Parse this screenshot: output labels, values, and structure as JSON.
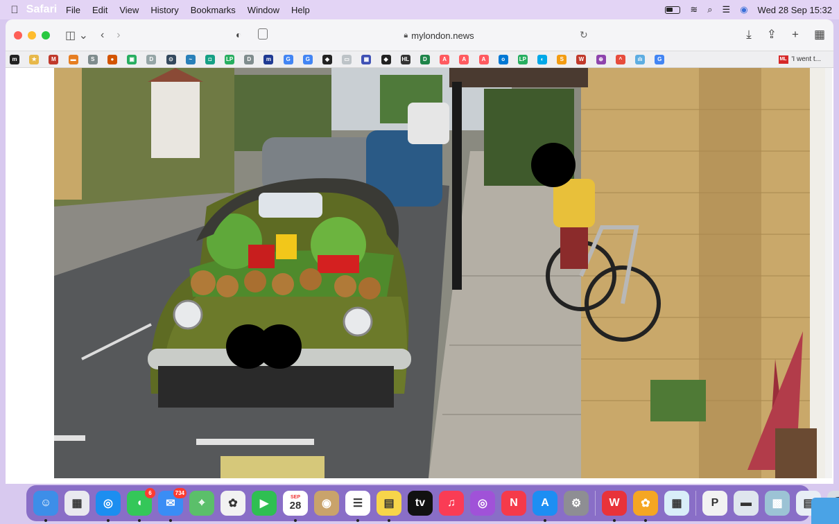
{
  "menubar": {
    "app_name": "Safari",
    "menus": [
      "File",
      "Edit",
      "View",
      "History",
      "Bookmarks",
      "Window",
      "Help"
    ],
    "datetime": "Wed 28 Sep  15:32"
  },
  "toolbar": {
    "url": "mylondon.news"
  },
  "favorites": [
    {
      "label": "m",
      "color": "#222222"
    },
    {
      "label": "★",
      "color": "#e7b84a"
    },
    {
      "label": "M",
      "color": "#c0392b"
    },
    {
      "label": "▬",
      "color": "#e67e22"
    },
    {
      "label": "S",
      "color": "#7f8c8d"
    },
    {
      "label": "●",
      "color": "#d35400"
    },
    {
      "label": "▣",
      "color": "#27ae60"
    },
    {
      "label": "D",
      "color": "#95a5a6"
    },
    {
      "label": "⊙",
      "color": "#34495e"
    },
    {
      "label": "~",
      "color": "#2980b9"
    },
    {
      "label": "◘",
      "color": "#16a085"
    },
    {
      "label": "LP",
      "color": "#27ae60"
    },
    {
      "label": "D",
      "color": "#7f8c8d"
    },
    {
      "label": "m",
      "color": "#1f3a93"
    },
    {
      "label": "G",
      "color": "#4285f4"
    },
    {
      "label": "G",
      "color": "#4285f4"
    },
    {
      "label": "◆",
      "color": "#222222"
    },
    {
      "label": "▭",
      "color": "#bdc3c7"
    },
    {
      "label": "▦",
      "color": "#3f51b5"
    },
    {
      "label": "◆",
      "color": "#222222"
    },
    {
      "label": "HL",
      "color": "#333333"
    },
    {
      "label": "D",
      "color": "#1e8449"
    },
    {
      "label": "A",
      "color": "#ff5a5f"
    },
    {
      "label": "A",
      "color": "#ff5a5f"
    },
    {
      "label": "A",
      "color": "#ff5a5f"
    },
    {
      "label": "o",
      "color": "#0078d4"
    },
    {
      "label": "LP",
      "color": "#27ae60"
    },
    {
      "label": "◐",
      "color": "#00a8e8"
    },
    {
      "label": "S",
      "color": "#f39c12"
    },
    {
      "label": "W",
      "color": "#c0392b"
    },
    {
      "label": "⊕",
      "color": "#8e44ad"
    },
    {
      "label": "^",
      "color": "#e74c3c"
    },
    {
      "label": "ılı",
      "color": "#5dade2"
    },
    {
      "label": "G",
      "color": "#4285f4"
    }
  ],
  "favorites_last": {
    "logo": "ML",
    "label": "'I went t..."
  },
  "dock": {
    "apps": [
      {
        "name": "finder",
        "label": "☺",
        "color": "#3d8ee8"
      },
      {
        "name": "launchpad",
        "label": "▦",
        "color": "#e9e9ef"
      },
      {
        "name": "safari",
        "label": "◎",
        "color": "#1c8ef0"
      },
      {
        "name": "messages",
        "label": "◖",
        "color": "#34c759",
        "badge": "6"
      },
      {
        "name": "mail",
        "label": "✉",
        "color": "#3a8df5",
        "badge": "734"
      },
      {
        "name": "maps",
        "label": "⌖",
        "color": "#5bbf6a"
      },
      {
        "name": "photos",
        "label": "✿",
        "color": "#f2f2f2"
      },
      {
        "name": "facetime",
        "label": "▶",
        "color": "#2fbf52"
      },
      {
        "name": "calendar",
        "label": "28",
        "color": "#ffffff",
        "sublabel": "SEP"
      },
      {
        "name": "contacts",
        "label": "◉",
        "color": "#c9a36b"
      },
      {
        "name": "reminders",
        "label": "☰",
        "color": "#ffffff"
      },
      {
        "name": "notes",
        "label": "▤",
        "color": "#f7d54a"
      },
      {
        "name": "tv",
        "label": "tv",
        "color": "#111111"
      },
      {
        "name": "music",
        "label": "♫",
        "color": "#fa3c55"
      },
      {
        "name": "podcasts",
        "label": "◎",
        "color": "#a052d8"
      },
      {
        "name": "news",
        "label": "N",
        "color": "#f53a4a"
      },
      {
        "name": "appstore",
        "label": "A",
        "color": "#1d8ef3"
      },
      {
        "name": "systemprefs",
        "label": "⚙",
        "color": "#8e8e93"
      },
      {
        "name": "wps",
        "label": "W",
        "color": "#e8333a"
      },
      {
        "name": "flower",
        "label": "✿",
        "color": "#f5a623"
      },
      {
        "name": "preview",
        "label": "▦",
        "color": "#d9eef9"
      },
      {
        "name": "pdf",
        "label": "P",
        "color": "#f2f2f2"
      },
      {
        "name": "doc1",
        "label": "▬",
        "color": "#dfe6ee"
      },
      {
        "name": "doc2",
        "label": "▩",
        "color": "#9cc3d5"
      },
      {
        "name": "doc3",
        "label": "▤",
        "color": "#e8eef5"
      },
      {
        "name": "trash",
        "label": "🗑",
        "color": "#d8dde3"
      }
    ]
  }
}
